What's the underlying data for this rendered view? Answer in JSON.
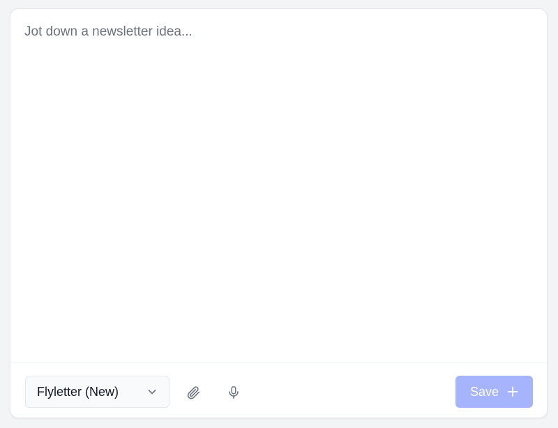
{
  "editor": {
    "value": "",
    "placeholder": "Jot down a newsletter idea..."
  },
  "footer": {
    "newsletter_select": {
      "selected": "Flyletter (New)",
      "icon": "chevron-down-icon"
    },
    "attach_icon": "paperclip-icon",
    "mic_icon": "microphone-icon",
    "save": {
      "label": "Save",
      "icon": "plus-icon",
      "disabled": true
    }
  },
  "colors": {
    "background": "#f3f4f6",
    "card": "#ffffff",
    "placeholder": "#6b7280",
    "icon": "#6b7280",
    "save_button": "#a5b4fc",
    "save_text": "#ffffff",
    "select_bg": "#f9fafb",
    "border": "#e5e7eb"
  }
}
